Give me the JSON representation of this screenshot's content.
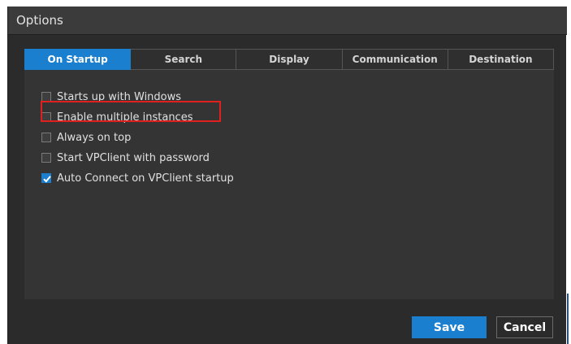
{
  "window": {
    "title": "Options"
  },
  "tabs": [
    {
      "label": "On Startup",
      "active": true
    },
    {
      "label": "Search",
      "active": false
    },
    {
      "label": "Display",
      "active": false
    },
    {
      "label": "Communication",
      "active": false
    },
    {
      "label": "Destination",
      "active": false
    }
  ],
  "options": [
    {
      "label": "Starts up with Windows",
      "checked": false
    },
    {
      "label": "Enable multiple instances",
      "checked": false
    },
    {
      "label": "Always on top",
      "checked": false
    },
    {
      "label": "Start VPClient with password",
      "checked": false
    },
    {
      "label": "Auto Connect on VPClient startup",
      "checked": true
    }
  ],
  "buttons": {
    "save": "Save",
    "cancel": "Cancel"
  },
  "colors": {
    "accent": "#1a7fcf",
    "highlight": "#e01f1f",
    "dialog_bg": "#2b2b2b",
    "panel_bg": "#343434"
  },
  "icons": {
    "checkmark": "checkmark-icon"
  }
}
